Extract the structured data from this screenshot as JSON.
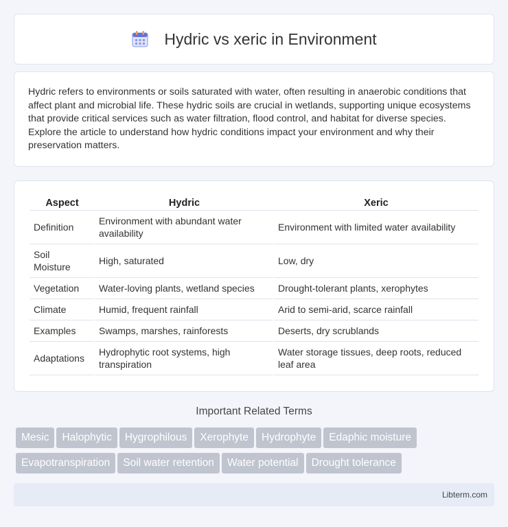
{
  "header": {
    "title": "Hydric vs xeric in Environment",
    "icon": "calendar-icon"
  },
  "intro": "Hydric refers to environments or soils saturated with water, often resulting in anaerobic conditions that affect plant and microbial life. These hydric soils are crucial in wetlands, supporting unique ecosystems that provide critical services such as water filtration, flood control, and habitat for diverse species. Explore the article to understand how hydric conditions impact your environment and why their preservation matters.",
  "table": {
    "headers": [
      "Aspect",
      "Hydric",
      "Xeric"
    ],
    "rows": [
      [
        "Definition",
        "Environment with abundant water availability",
        "Environment with limited water availability"
      ],
      [
        "Soil Moisture",
        "High, saturated",
        "Low, dry"
      ],
      [
        "Vegetation",
        "Water-loving plants, wetland species",
        "Drought-tolerant plants, xerophytes"
      ],
      [
        "Climate",
        "Humid, frequent rainfall",
        "Arid to semi-arid, scarce rainfall"
      ],
      [
        "Examples",
        "Swamps, marshes, rainforests",
        "Deserts, dry scrublands"
      ],
      [
        "Adaptations",
        "Hydrophytic root systems, high transpiration",
        "Water storage tissues, deep roots, reduced leaf area"
      ]
    ]
  },
  "related": {
    "title": "Important Related Terms",
    "terms": [
      "Mesic",
      "Halophytic",
      "Hygrophilous",
      "Xerophyte",
      "Hydrophyte",
      "Edaphic moisture",
      "Evapotranspiration",
      "Soil water retention",
      "Water potential",
      "Drought tolerance"
    ]
  },
  "footer": {
    "site": "Libterm.com"
  },
  "colors": {
    "background": "#f3f5fa",
    "tag": "#bfc4cf",
    "footer": "#e6ebf6"
  }
}
